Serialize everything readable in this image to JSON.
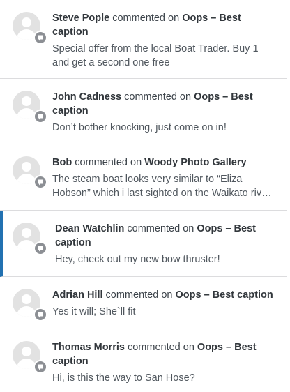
{
  "notifications": [
    {
      "author": "Steve Pople",
      "verb": "commented on",
      "post": "Oops – Best caption",
      "excerpt": "Special offer from the local Boat Trader. Buy 1 and get a second one free"
    },
    {
      "author": "John Cadness",
      "verb": "commented on",
      "post": "Oops – Best caption",
      "excerpt": "Don’t bother knocking, just come on in!"
    },
    {
      "author": "Bob",
      "verb": "commented on",
      "post": "Woody Photo Gallery",
      "excerpt": "The steam boat looks very similar to “Eliza Hobson” which i last sighted on the Waikato river at Mercer"
    },
    {
      "author": "Dean Watchlin",
      "verb": "commented on",
      "post": "Oops – Best caption",
      "excerpt": "Hey, check out my new bow thruster!"
    },
    {
      "author": "Adrian Hill",
      "verb": "commented on",
      "post": "Oops – Best caption",
      "excerpt": "Yes it will; She`ll fit"
    },
    {
      "author": "Thomas Morris",
      "verb": "commented on",
      "post": "Oops – Best caption",
      "excerpt": "Hi, is this the way to San Hose?"
    }
  ],
  "icons": {
    "avatar": "default-avatar-icon",
    "badge": "comment-icon"
  },
  "colors": {
    "active_indicator": "#2271b1",
    "badge": "#8c8f94"
  }
}
